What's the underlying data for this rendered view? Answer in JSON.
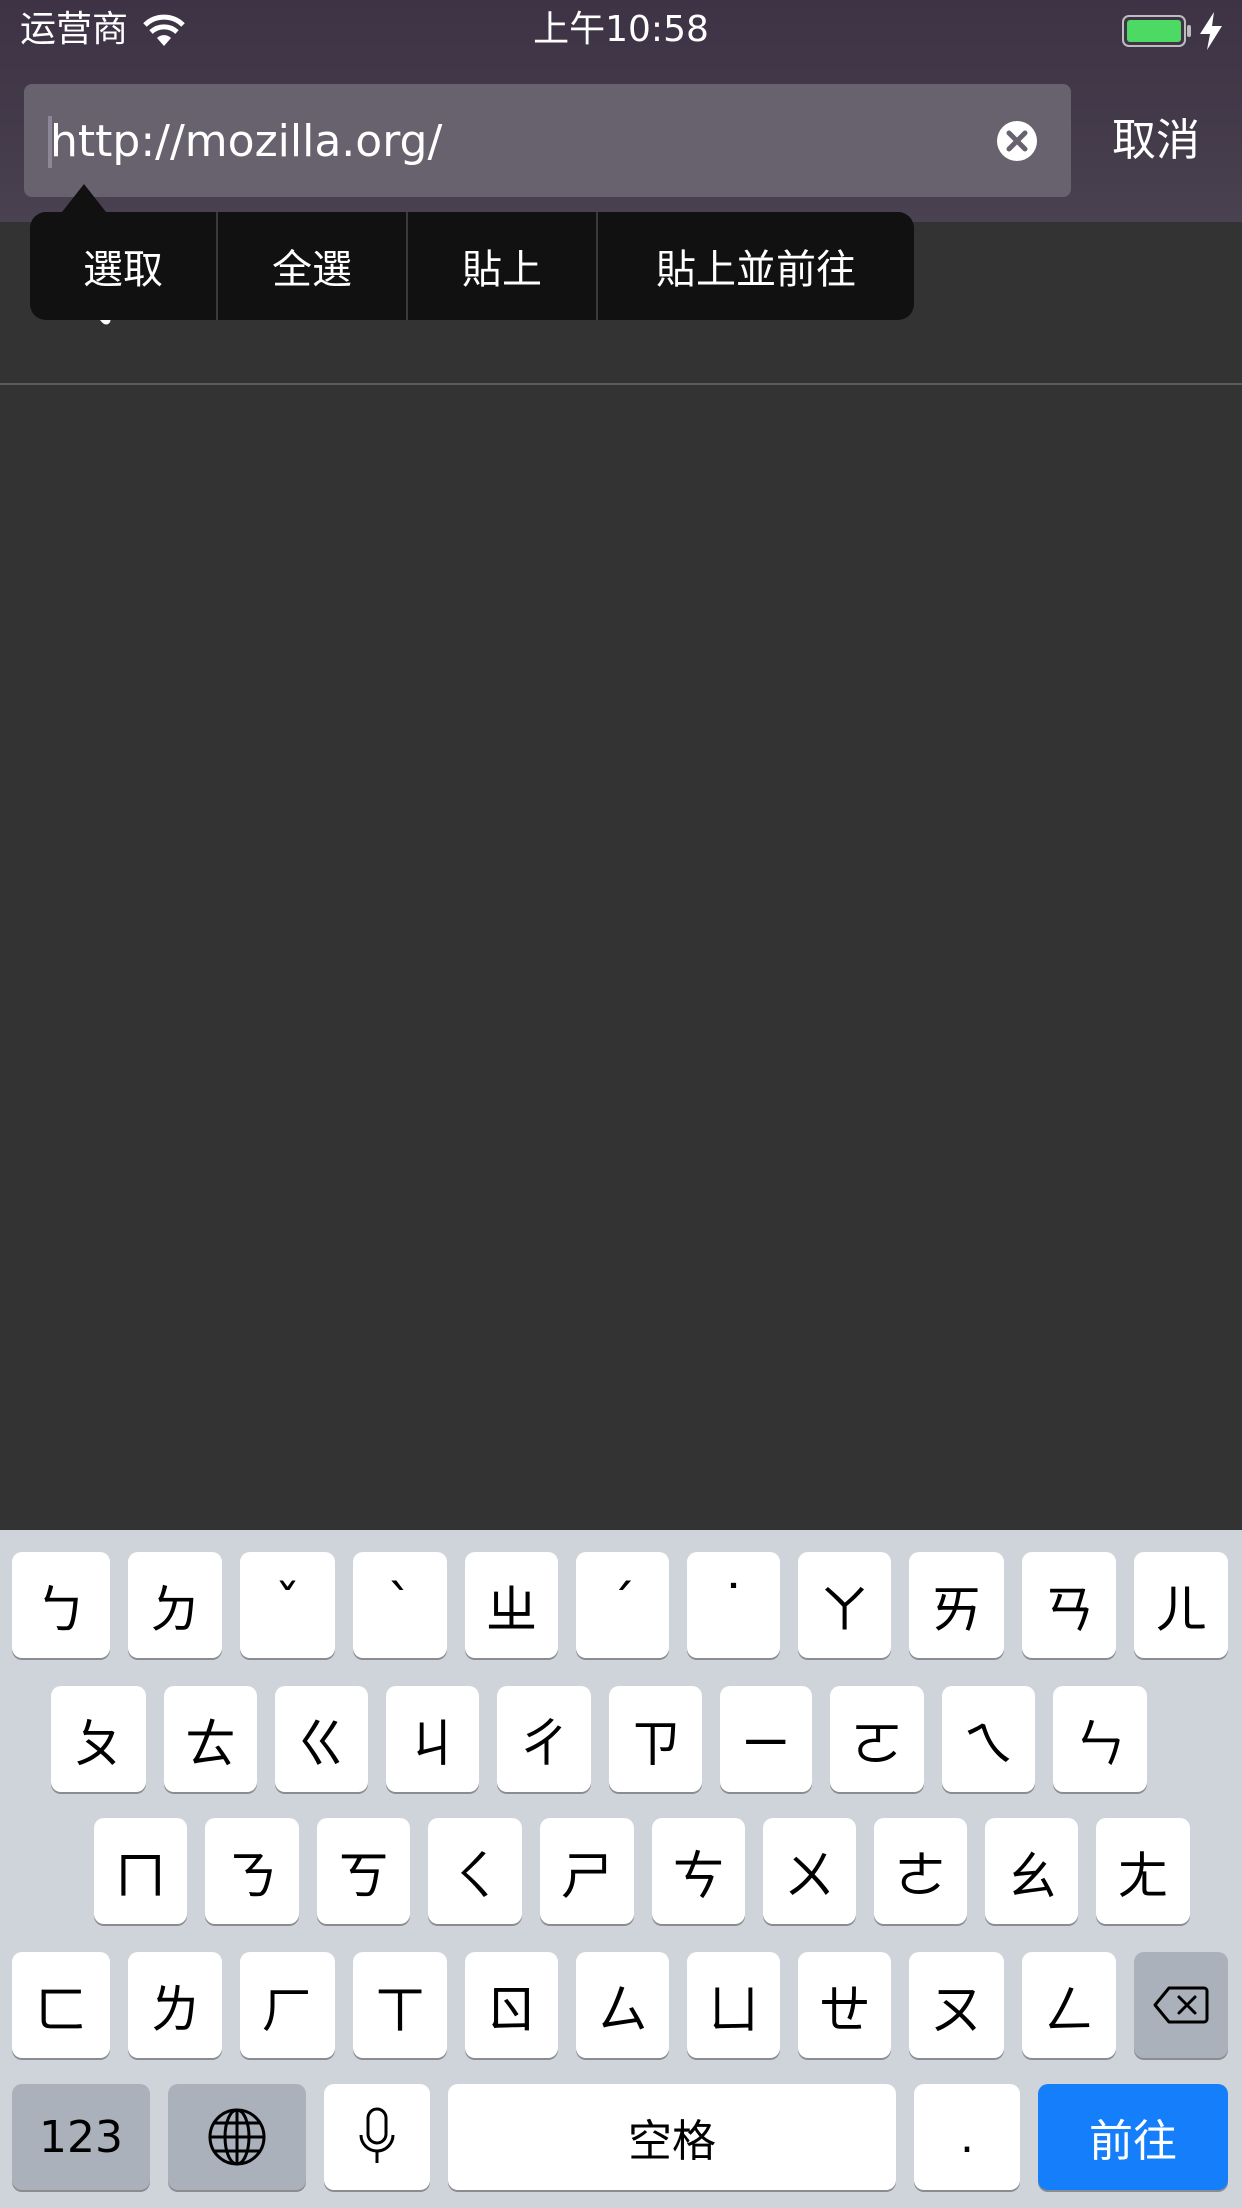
{
  "status": {
    "carrier": "运营商",
    "time": "上午10:58"
  },
  "url_bar": {
    "value": "http://mozilla.org/",
    "cancel_label": "取消"
  },
  "edit_menu": {
    "items": [
      "選取",
      "全選",
      "貼上",
      "貼上並前往"
    ]
  },
  "keyboard": {
    "row1": [
      "ㄅ",
      "ㄉ",
      "ˇ",
      "ˋ",
      "ㄓ",
      "ˊ",
      "˙",
      "ㄚ",
      "ㄞ",
      "ㄢ",
      "ㄦ"
    ],
    "row2": [
      "ㄆ",
      "ㄊ",
      "ㄍ",
      "ㄐ",
      "ㄔ",
      "ㄗ",
      "ㄧ",
      "ㄛ",
      "ㄟ",
      "ㄣ"
    ],
    "row3": [
      "ㄇ",
      "ㄋ",
      "ㄎ",
      "ㄑ",
      "ㄕ",
      "ㄘ",
      "ㄨ",
      "ㄜ",
      "ㄠ",
      "ㄤ"
    ],
    "row4": [
      "ㄈ",
      "ㄌ",
      "ㄏ",
      "ㄒ",
      "ㄖ",
      "ㄙ",
      "ㄩ",
      "ㄝ",
      "ㄡ",
      "ㄥ"
    ],
    "numbers_label": "123",
    "space_label": "空格",
    "period_label": ".",
    "go_label": "前往"
  },
  "colors": {
    "go_key": "#157efb",
    "background": "#333333",
    "keyboard": "#cfd3da"
  }
}
